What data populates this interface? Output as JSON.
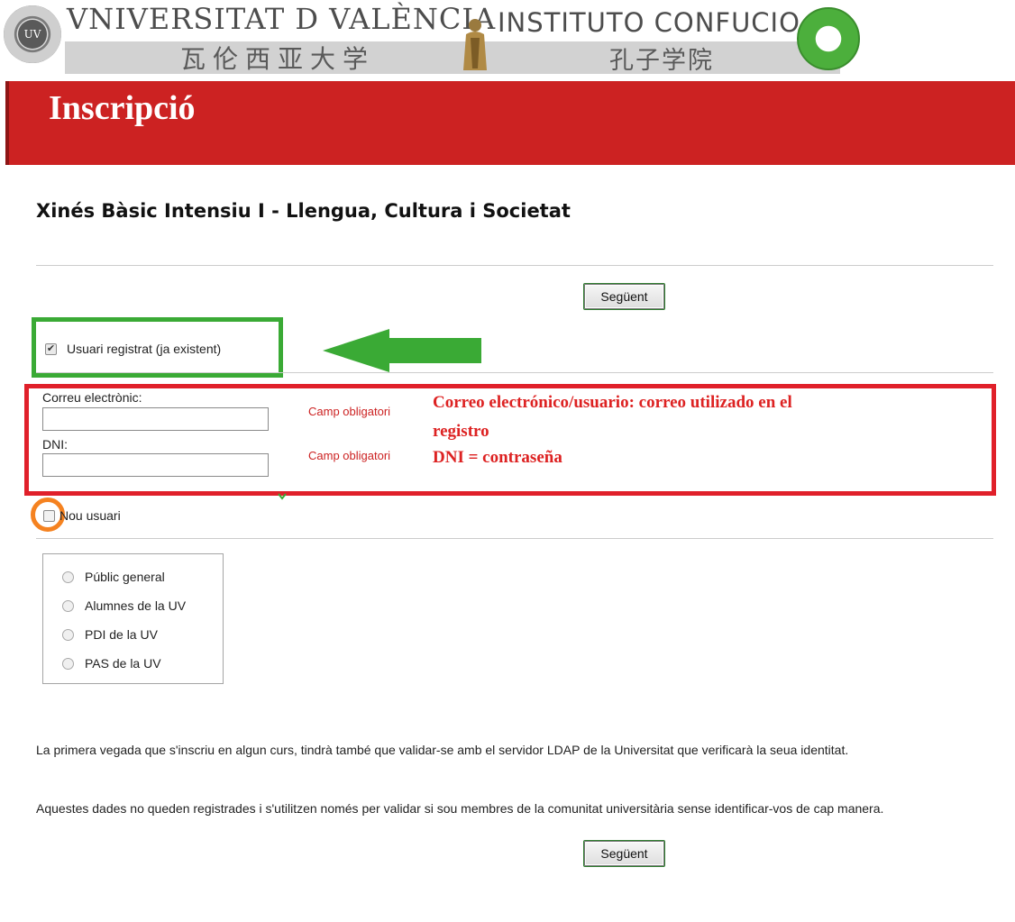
{
  "header": {
    "uv_seal_text": "UV",
    "uv_title": "VNIVERSITAT D VALÈNCIA",
    "uv_chinese": "瓦伦西亚大学",
    "ic_title": "INSTITUTO CONFUCIO",
    "ic_chinese": "孔子学院"
  },
  "banner": {
    "title": "Inscripció"
  },
  "course": {
    "title": "Xinés Bàsic Intensiu I - Llengua, Cultura i Societat"
  },
  "buttons": {
    "next_top": "Següent",
    "next_bottom": "Següent"
  },
  "existing_user": {
    "label": "Usuari registrat (ja existent)",
    "checked": true
  },
  "login_form": {
    "email_label": "Correu electrònic:",
    "email_value": "",
    "dni_label": "DNI:",
    "dni_value": "",
    "required_email": "Camp obligatori",
    "required_dni": "Camp obligatori"
  },
  "annotations": {
    "note_line1": "Correo electrónico/usuario: correo utilizado en el",
    "note_line2": "registro",
    "note_line3": "DNI = contraseña",
    "green_color": "#3aaa35",
    "red_color": "#e0202a",
    "orange_color": "#f58220"
  },
  "new_user": {
    "label": "Nou usuari",
    "checked": false
  },
  "user_types": [
    {
      "label": "Públic general"
    },
    {
      "label": "Alumnes de la UV"
    },
    {
      "label": "PDI de la UV"
    },
    {
      "label": "PAS de la UV"
    }
  ],
  "info": {
    "paragraph1": "La primera vegada que s'inscriu en algun curs, tindrà també que validar-se amb el servidor LDAP de la Universitat que verificarà la seua identitat.",
    "paragraph2": "Aquestes dades no queden registrades i s'utilitzen només per validar si sou membres de la comunitat universitària sense identificar-vos de cap manera."
  }
}
